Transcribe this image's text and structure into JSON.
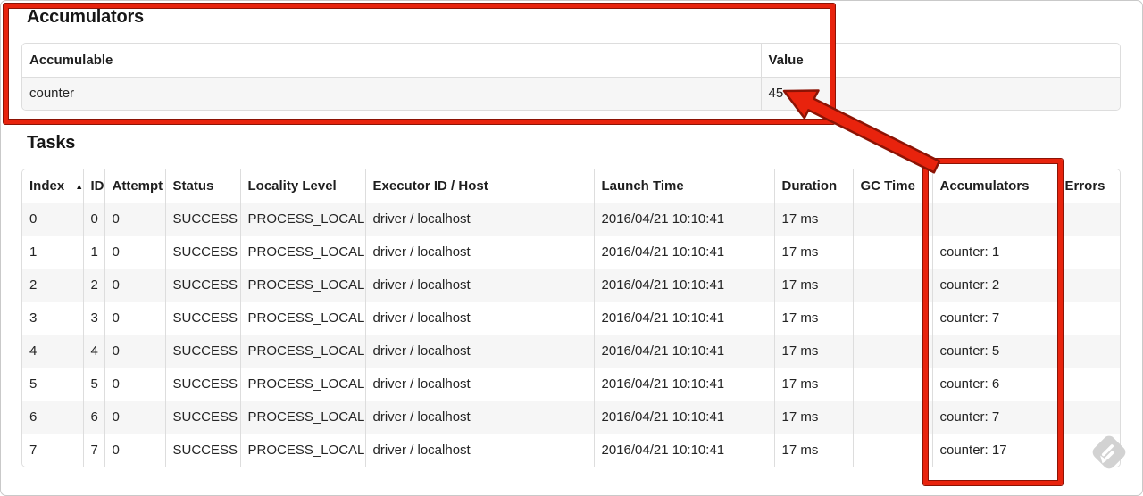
{
  "accumulators_section": {
    "title": "Accumulators",
    "table": {
      "headers": [
        "Accumulable",
        "Value"
      ],
      "rows": [
        [
          "counter",
          "45"
        ]
      ]
    }
  },
  "tasks_section": {
    "title": "Tasks",
    "table": {
      "headers": [
        "Index",
        "ID",
        "Attempt",
        "Status",
        "Locality Level",
        "Executor ID / Host",
        "Launch Time",
        "Duration",
        "GC Time",
        "Accumulators",
        "Errors"
      ],
      "sort_indicator": "▲",
      "sorted_column": "Index",
      "rows": [
        [
          "0",
          "0",
          "0",
          "SUCCESS",
          "PROCESS_LOCAL",
          "driver / localhost",
          "2016/04/21 10:10:41",
          "17 ms",
          "",
          "",
          ""
        ],
        [
          "1",
          "1",
          "0",
          "SUCCESS",
          "PROCESS_LOCAL",
          "driver / localhost",
          "2016/04/21 10:10:41",
          "17 ms",
          "",
          "counter: 1",
          ""
        ],
        [
          "2",
          "2",
          "0",
          "SUCCESS",
          "PROCESS_LOCAL",
          "driver / localhost",
          "2016/04/21 10:10:41",
          "17 ms",
          "",
          "counter: 2",
          ""
        ],
        [
          "3",
          "3",
          "0",
          "SUCCESS",
          "PROCESS_LOCAL",
          "driver / localhost",
          "2016/04/21 10:10:41",
          "17 ms",
          "",
          "counter: 7",
          ""
        ],
        [
          "4",
          "4",
          "0",
          "SUCCESS",
          "PROCESS_LOCAL",
          "driver / localhost",
          "2016/04/21 10:10:41",
          "17 ms",
          "",
          "counter: 5",
          ""
        ],
        [
          "5",
          "5",
          "0",
          "SUCCESS",
          "PROCESS_LOCAL",
          "driver / localhost",
          "2016/04/21 10:10:41",
          "17 ms",
          "",
          "counter: 6",
          ""
        ],
        [
          "6",
          "6",
          "0",
          "SUCCESS",
          "PROCESS_LOCAL",
          "driver / localhost",
          "2016/04/21 10:10:41",
          "17 ms",
          "",
          "counter: 7",
          ""
        ],
        [
          "7",
          "7",
          "0",
          "SUCCESS",
          "PROCESS_LOCAL",
          "driver / localhost",
          "2016/04/21 10:10:41",
          "17 ms",
          "",
          "counter: 17",
          ""
        ]
      ]
    }
  },
  "annotations": {
    "highlight_color": "#e8230d",
    "outline_color": "#8c1305",
    "watermark_color": "#d2d2d2"
  }
}
